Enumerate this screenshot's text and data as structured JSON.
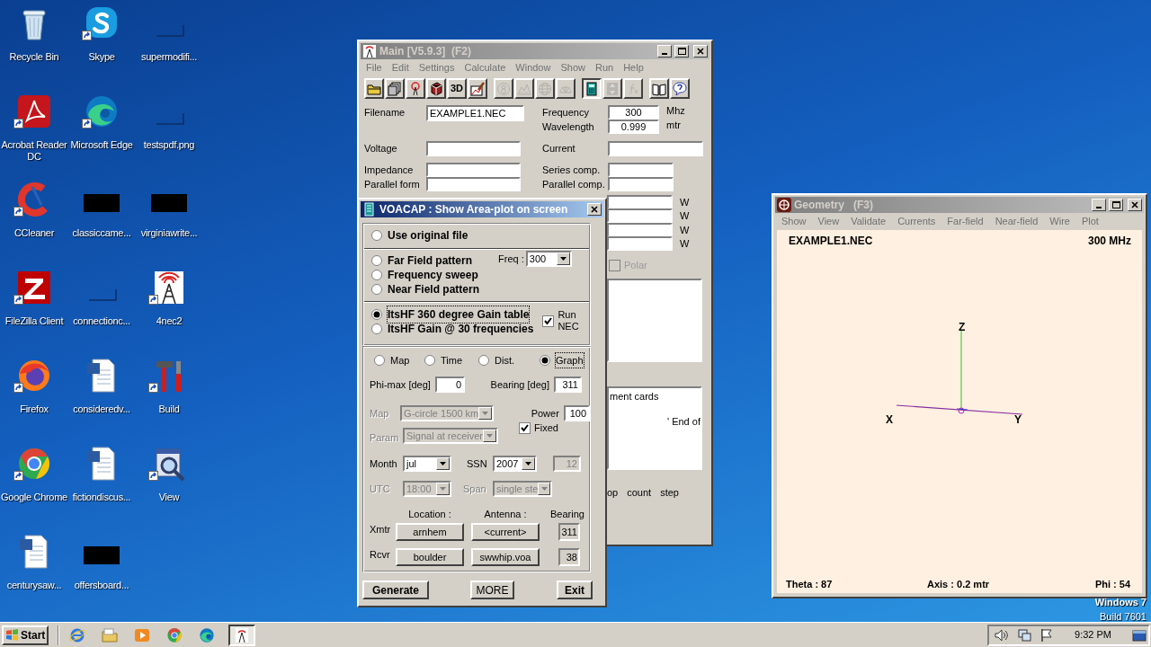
{
  "desktop_icons": [
    {
      "label": "Recycle Bin",
      "kind": "recycle-bin",
      "shortcut": false
    },
    {
      "label": "Skype",
      "kind": "skype",
      "shortcut": true
    },
    {
      "label": "supermodifi...",
      "kind": "blank",
      "shortcut": false
    },
    {
      "label": "Acrobat Reader DC",
      "kind": "acrobat",
      "shortcut": true
    },
    {
      "label": "Microsoft Edge",
      "kind": "edge",
      "shortcut": true
    },
    {
      "label": "testspdf.png",
      "kind": "blank",
      "shortcut": false
    },
    {
      "label": "CCleaner",
      "kind": "ccleaner",
      "shortcut": true
    },
    {
      "label": "classiccame...",
      "kind": "redacted",
      "shortcut": false
    },
    {
      "label": "virginiawrite...",
      "kind": "redacted",
      "shortcut": false
    },
    {
      "label": "FileZilla Client",
      "kind": "filezilla",
      "shortcut": true
    },
    {
      "label": "connectionc...",
      "kind": "blank",
      "shortcut": false
    },
    {
      "label": "4nec2",
      "kind": "antenna",
      "shortcut": true
    },
    {
      "label": "Firefox",
      "kind": "firefox",
      "shortcut": true
    },
    {
      "label": "consideredv...",
      "kind": "document",
      "shortcut": false
    },
    {
      "label": "Build",
      "kind": "tools",
      "shortcut": true
    },
    {
      "label": "Google Chrome",
      "kind": "chrome",
      "shortcut": true
    },
    {
      "label": "fictiondiscus...",
      "kind": "document",
      "shortcut": false
    },
    {
      "label": "View",
      "kind": "viewer",
      "shortcut": true
    },
    {
      "label": "centurysaw...",
      "kind": "document",
      "shortcut": false
    },
    {
      "label": "offersboard...",
      "kind": "redacted",
      "shortcut": false
    }
  ],
  "main_window": {
    "title": "Main [V5.9.3]  (F2)",
    "active": false,
    "menu": [
      "File",
      "Edit",
      "Settings",
      "Calculate",
      "Window",
      "Show",
      "Run",
      "Help"
    ],
    "toolbar": [
      [
        {
          "kind": "folder",
          "disabled": false,
          "pressed": false
        },
        {
          "kind": "pages",
          "disabled": false,
          "pressed": false
        },
        {
          "kind": "antenna",
          "disabled": false,
          "pressed": false
        },
        {
          "kind": "cube",
          "disabled": false,
          "pressed": false
        },
        {
          "kind": "label",
          "label": "3D",
          "disabled": false,
          "pressed": false
        },
        {
          "kind": "pencil-chart",
          "disabled": false,
          "pressed": false
        }
      ],
      [
        {
          "kind": "ring",
          "disabled": true,
          "pressed": false
        },
        {
          "kind": "hills",
          "disabled": true,
          "pressed": false
        },
        {
          "kind": "globe",
          "disabled": true,
          "pressed": false
        },
        {
          "kind": "pattern",
          "disabled": true,
          "pressed": false
        }
      ],
      [
        {
          "kind": "calculator",
          "disabled": false,
          "pressed": true
        },
        {
          "kind": "arrows",
          "disabled": true,
          "pressed": false
        },
        {
          "kind": "function",
          "disabled": true,
          "pressed": false
        }
      ],
      [
        {
          "kind": "book",
          "disabled": false,
          "pressed": false
        },
        {
          "kind": "help",
          "disabled": false,
          "pressed": false
        }
      ]
    ],
    "filename": {
      "label": "Filename",
      "value": "EXAMPLE1.NEC"
    },
    "frequency": {
      "label": "Frequency",
      "value": "300",
      "unit": "Mhz"
    },
    "wavelength": {
      "label": "Wavelength",
      "value": "0.999",
      "unit": "mtr"
    },
    "voltage": {
      "label": "Voltage"
    },
    "current": {
      "label": "Current"
    },
    "impedance": {
      "label": "Impedance"
    },
    "parallel_form": {
      "label": "Parallel form"
    },
    "series_comp": {
      "label": "Series comp."
    },
    "parallel_comp": {
      "label": "Parallel comp."
    },
    "power_units": [
      "W",
      "W",
      "W",
      "W"
    ],
    "polar": {
      "label": "Polar",
      "checked": false,
      "disabled": true
    },
    "comment_lines": [
      "ment cards",
      "' End of"
    ],
    "footer_labels": [
      "op",
      "count",
      "step"
    ]
  },
  "voacap_dialog": {
    "title": "VOACAP : Show Area-plot on screen",
    "active": true,
    "source_groups": [
      [
        {
          "label": "Use original file",
          "selected": false
        }
      ],
      [
        {
          "label": "Far Field pattern",
          "selected": false
        },
        {
          "label": "Frequency sweep",
          "selected": false
        },
        {
          "label": "Near Field pattern",
          "selected": false
        }
      ],
      [
        {
          "label": "ItsHF 360 degree Gain table",
          "selected": true
        },
        {
          "label": "ItsHF Gain @ 30 frequencies",
          "selected": false
        }
      ]
    ],
    "freq": {
      "label": "Freq :",
      "value": "300"
    },
    "run_nec": {
      "label": "Run NEC",
      "checked": true
    },
    "plot_types": [
      {
        "label": "Map",
        "selected": false
      },
      {
        "label": "Time",
        "selected": false
      },
      {
        "label": "Dist.",
        "selected": false
      },
      {
        "label": "Graph",
        "selected": true
      }
    ],
    "phi_max": {
      "label": "Phi-max [deg]",
      "value": "0"
    },
    "bearing": {
      "label": "Bearing [deg]",
      "value": "311"
    },
    "map": {
      "label": "Map",
      "value": "G-circle 1500 km",
      "disabled": true
    },
    "power": {
      "label": "Power",
      "value": "100"
    },
    "param": {
      "label": "Param",
      "value": "Signal at receiver",
      "disabled": true
    },
    "fixed": {
      "label": "Fixed",
      "checked": true
    },
    "month": {
      "label": "Month",
      "value": "jul"
    },
    "ssn": {
      "label": "SSN",
      "value": "2007"
    },
    "ssn_value": {
      "value": "12",
      "disabled": true
    },
    "utc": {
      "label": "UTC",
      "value": "18:00",
      "disabled": true
    },
    "span": {
      "label": "Span",
      "value": "single ste",
      "disabled": true
    },
    "column_headers": [
      "Location :",
      "Antenna :",
      "Bearing"
    ],
    "stations": [
      {
        "label": "Xmtr",
        "location": "arnhem",
        "antenna": "<current>",
        "bearing": "311"
      },
      {
        "label": "Rcvr",
        "location": "boulder",
        "antenna": "swwhip.voa",
        "bearing": "38"
      }
    ],
    "buttons": [
      {
        "label": "Generate",
        "bold": true
      },
      {
        "label": "MORE",
        "bold": false
      },
      {
        "label": "Exit",
        "bold": true
      }
    ]
  },
  "geometry_window": {
    "title": "Geometry   (F3)",
    "active": false,
    "menu": [
      "Show",
      "View",
      "Validate",
      "Currents",
      "Far-field",
      "Near-field",
      "Wire",
      "Plot"
    ],
    "filename": "EXAMPLE1.NEC",
    "frequency": "300 MHz",
    "axes": {
      "z": "Z",
      "x": "X",
      "y": "Y"
    },
    "theta": "Theta : 87",
    "axis_scale": "Axis : 0.2 mtr",
    "phi": "Phi : 54"
  },
  "os_notice": {
    "edition": "Windows 7",
    "build": "Build 7601"
  },
  "taskbar": {
    "start": "Start",
    "pinned": [
      {
        "kind": "ie",
        "active": false
      },
      {
        "kind": "folder",
        "active": false
      },
      {
        "kind": "media",
        "active": false
      },
      {
        "kind": "chrome",
        "active": false
      },
      {
        "kind": "edge",
        "active": false
      },
      {
        "kind": "antenna",
        "active": true
      }
    ],
    "clock": "9:32 PM"
  }
}
